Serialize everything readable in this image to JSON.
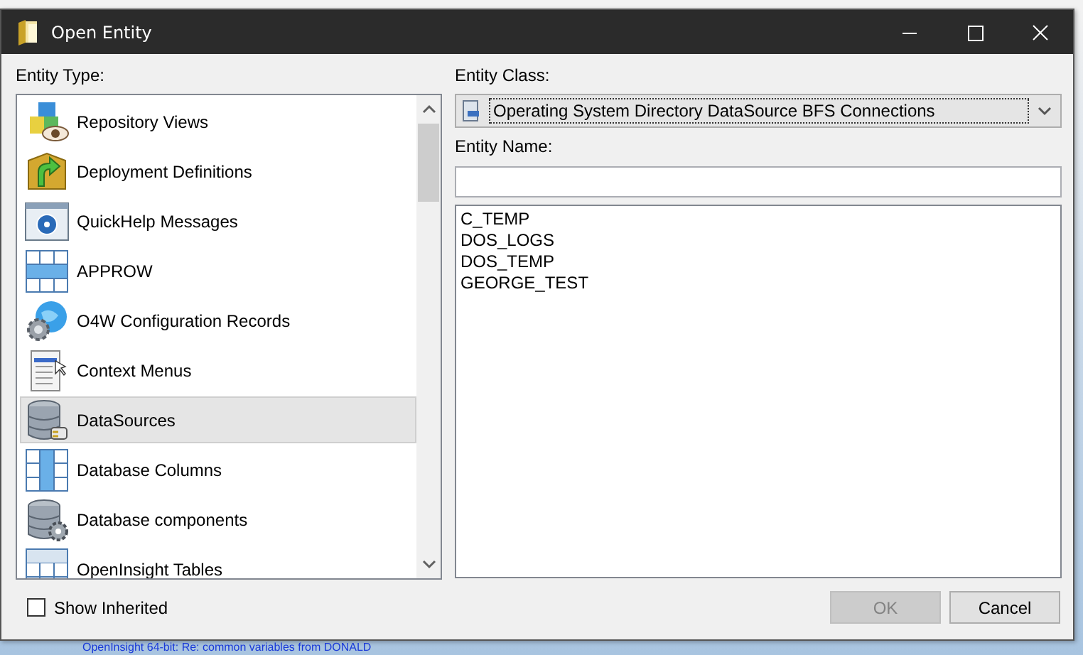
{
  "window": {
    "title": "Open Entity"
  },
  "entity_type": {
    "label": "Entity Type:",
    "items": [
      {
        "label": "Repository Views",
        "selected": false
      },
      {
        "label": "Deployment Definitions",
        "selected": false
      },
      {
        "label": "QuickHelp Messages",
        "selected": false
      },
      {
        "label": "APPROW",
        "selected": false
      },
      {
        "label": "O4W Configuration Records",
        "selected": false
      },
      {
        "label": "Context Menus",
        "selected": false
      },
      {
        "label": "DataSources",
        "selected": true
      },
      {
        "label": "Database Columns",
        "selected": false
      },
      {
        "label": "Database components",
        "selected": false
      },
      {
        "label": "OpenInsight Tables",
        "selected": false
      }
    ]
  },
  "entity_class": {
    "label": "Entity Class:",
    "value": "Operating System Directory DataSource BFS Connections"
  },
  "entity_name": {
    "label": "Entity Name:"
  },
  "names": [
    "C_TEMP",
    "DOS_LOGS",
    "DOS_TEMP",
    "GEORGE_TEST"
  ],
  "show_inherited": {
    "label": "Show Inherited",
    "checked": false
  },
  "buttons": [
    {
      "label": "OK",
      "disabled": true
    },
    {
      "label": "Cancel",
      "disabled": false
    }
  ],
  "background": {
    "link": "OpenInsight 64-bit: Re: common variables from DONALD"
  }
}
